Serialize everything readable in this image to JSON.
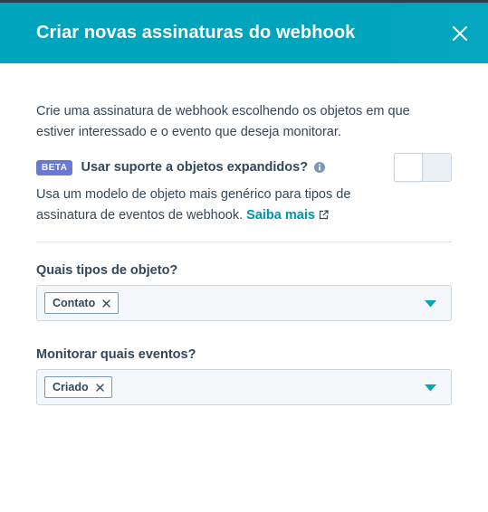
{
  "header": {
    "title": "Criar novas assinaturas do webhook",
    "close_icon": "close-icon",
    "background": "#00a4bd"
  },
  "intro": {
    "text": "Crie uma assinatura de webhook escolhendo os objetos em que estiver interessado e o evento que deseja monitorar."
  },
  "expanded_objects": {
    "badge": "BETA",
    "label": "Usar suporte a objetos expandidos?",
    "info_icon": "info-icon",
    "toggle_on": false,
    "description": "Usa um modelo de objeto mais genérico para tipos de assinatura de eventos de webhook.",
    "link_label": "Saiba mais",
    "link_icon": "external-link-icon"
  },
  "object_types": {
    "label": "Quais tipos de objeto?",
    "selected": [
      "Contato"
    ]
  },
  "events": {
    "label": "Monitorar quais eventos?",
    "selected": [
      "Criado"
    ]
  },
  "colors": {
    "accent": "#00a4bd",
    "link": "#0091ae",
    "badge": "#6a78d1",
    "text": "#33475b"
  }
}
